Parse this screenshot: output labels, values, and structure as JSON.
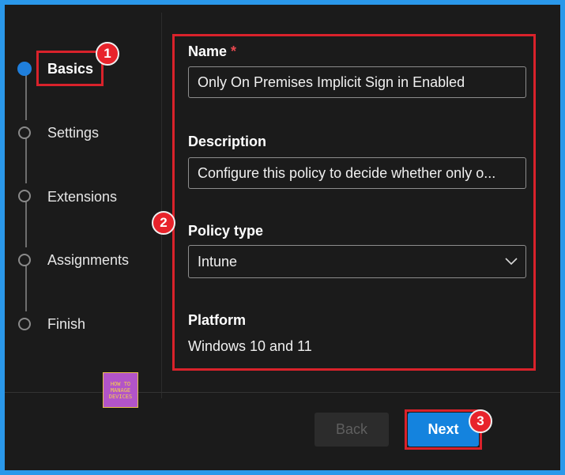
{
  "steps": [
    {
      "label": "Basics",
      "state": "active"
    },
    {
      "label": "Settings",
      "state": "pending"
    },
    {
      "label": "Extensions",
      "state": "pending"
    },
    {
      "label": "Assignments",
      "state": "pending"
    },
    {
      "label": "Finish",
      "state": "pending"
    }
  ],
  "form": {
    "name_label": "Name",
    "required_mark": "*",
    "name_value": "Only On Premises Implicit Sign in Enabled",
    "description_label": "Description",
    "description_value": "Configure this policy to decide whether only o...",
    "policy_type_label": "Policy type",
    "policy_type_value": "Intune",
    "platform_label": "Platform",
    "platform_value": "Windows 10 and 11"
  },
  "footer": {
    "back_label": "Back",
    "next_label": "Next"
  },
  "annotations": {
    "badge1": "1",
    "badge2": "2",
    "badge3": "3"
  },
  "logo": {
    "line1": "HOW TO",
    "line2": "MANAGE",
    "line3": "DEVICES"
  },
  "colors": {
    "accent": "#1483de",
    "annotation_red": "#d9222b",
    "frame_blue": "#2a98ea"
  },
  "icons": {
    "policy_type_dropdown": "chevron-down-icon"
  }
}
